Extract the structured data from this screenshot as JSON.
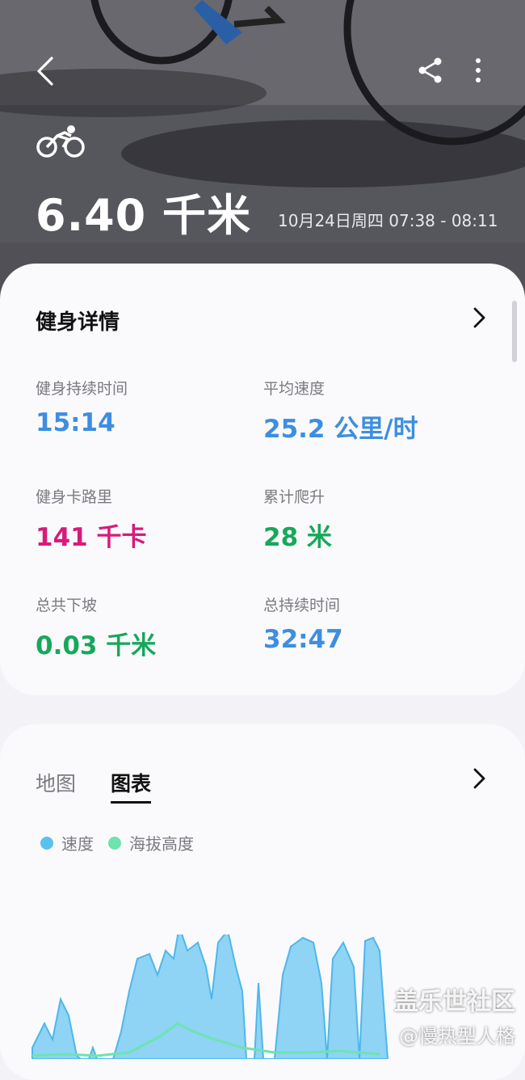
{
  "header": {
    "distance": "6.40 千米",
    "datetime": "10月24日周四 07:38 - 08:11",
    "back_icon": "chevron-left-icon",
    "share_icon": "share-icon",
    "more_icon": "more-vertical-icon",
    "activity_icon": "bicycle-icon"
  },
  "details": {
    "title": "健身详情",
    "stats": [
      {
        "label": "健身持续时间",
        "value": "15:14",
        "color": "#3d8ee0"
      },
      {
        "label": "平均速度",
        "value": "25.2 公里/时",
        "color": "#3d8ee0"
      },
      {
        "label": "健身卡路里",
        "value": "141 千卡",
        "color": "#d81b7a"
      },
      {
        "label": "累计爬升",
        "value": "28 米",
        "color": "#17a85a"
      },
      {
        "label": "总共下坡",
        "value": "0.03 千米",
        "color": "#17a85a"
      },
      {
        "label": "总持续时间",
        "value": "32:47",
        "color": "#3d8ee0"
      }
    ]
  },
  "charts_card": {
    "tabs": [
      {
        "label": "地图",
        "active": false
      },
      {
        "label": "图表",
        "active": true
      }
    ],
    "legend": [
      {
        "label": "速度",
        "color": "#5bc0f0"
      },
      {
        "label": "海拔高度",
        "color": "#6ee3b0"
      }
    ]
  },
  "watermark": {
    "line1": "盖乐世社区",
    "line2": "@慢热型人格"
  }
}
